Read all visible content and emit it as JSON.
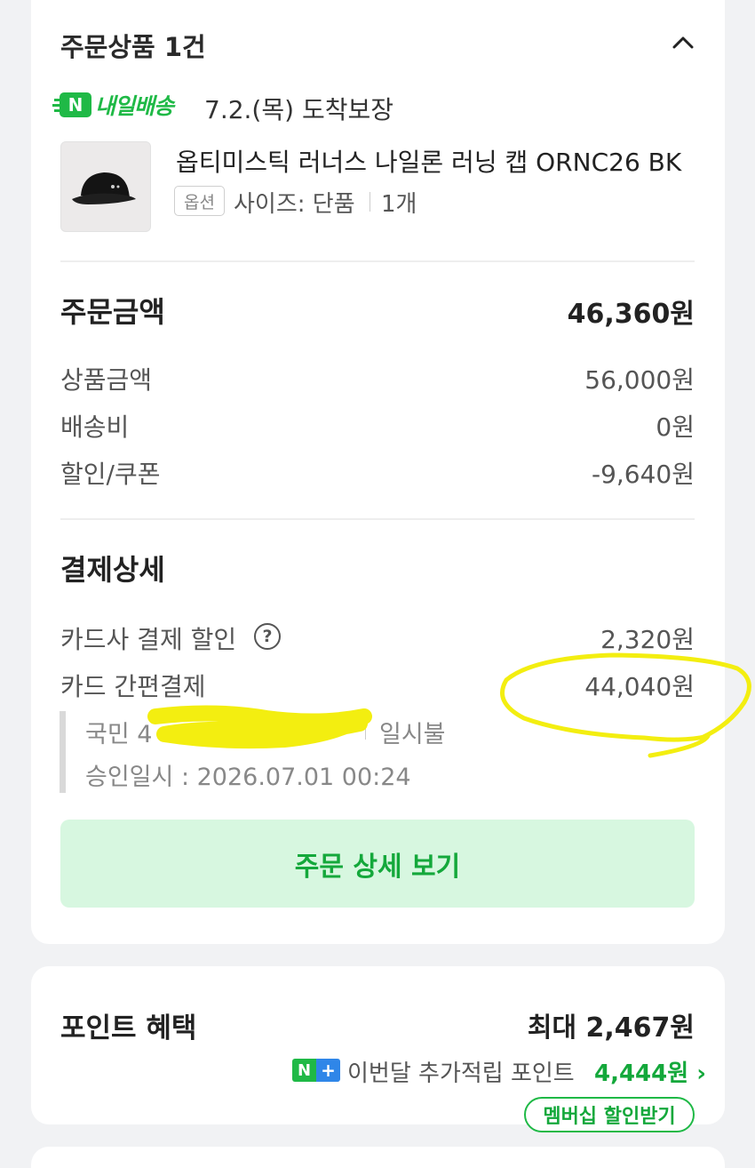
{
  "order": {
    "title": "주문상품 1건",
    "delivery_brand": "내일배송",
    "delivery_text": "7.2.(목) 도착보장",
    "product_name": "옵티미스틱 러너스 나일론 러닝 캡 ORNC26 BK",
    "option_tag": "옵션",
    "option_text": "사이즈: 단품",
    "quantity": "1개"
  },
  "amount": {
    "title": "주문금액",
    "total": "46,360원",
    "rows": [
      {
        "label": "상품금액",
        "value": "56,000원"
      },
      {
        "label": "배송비",
        "value": "0원"
      },
      {
        "label": "할인/쿠폰",
        "value": "-9,640원"
      }
    ]
  },
  "payment": {
    "title": "결제상세",
    "card_discount_label": "카드사 결제 할인",
    "card_discount_value": "2,320원",
    "easy_pay_label": "카드 간편결제",
    "easy_pay_value": "44,040원",
    "bank": "국민 4",
    "installment": "일시불",
    "approval": "승인일시 : 2026.07.01 00:24",
    "detail_button": "주문 상세 보기"
  },
  "points": {
    "title": "포인트 혜택",
    "max": "최대 2,467원",
    "extra_label": "이번달 추가적립 포인트",
    "extra_amount": "4,444원",
    "membership_button": "멤버십 할인받기"
  },
  "icons": {
    "collapse": "chevron-up-icon",
    "help": "question-circle-icon",
    "delivery": "naver-delivery-icon",
    "naver_plus": "naver-plus-icon"
  },
  "colors": {
    "accent_green": "#1fb946",
    "button_bg": "#d7f7e0",
    "highlight_yellow": "#f3ee10"
  }
}
